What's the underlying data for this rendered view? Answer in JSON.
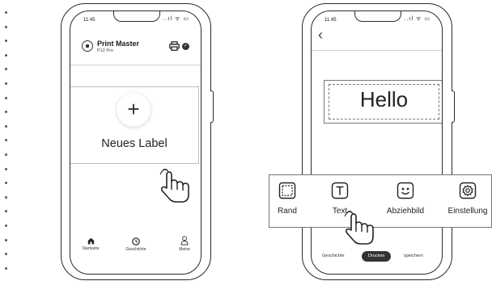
{
  "phone1": {
    "status_time": "11:45",
    "status_icons": "..ıl ᯤ ▭",
    "app_title": "Print Master",
    "app_model": "P12 Pro",
    "new_label": "Neues Label",
    "plus": "+",
    "tabs": [
      {
        "label": "Startseite",
        "icon": "home-icon"
      },
      {
        "label": "Geschichte",
        "icon": "clock-icon"
      },
      {
        "label": "Meine",
        "icon": "person-icon"
      }
    ]
  },
  "phone2": {
    "status_time": "11:45",
    "status_icons": "..ıl ᯤ ▭",
    "back": "‹",
    "label_text": "Hello",
    "tools": [
      {
        "label": "Rand",
        "icon": "border-frame-icon"
      },
      {
        "label": "Text",
        "icon": "text-t-icon"
      },
      {
        "label": "Abziehbild",
        "icon": "sticker-smile-icon"
      },
      {
        "label": "Einstellung",
        "icon": "settings-gear-icon"
      }
    ],
    "actions": {
      "history": "Geschichte",
      "print": "Drucken",
      "save": "speichern"
    }
  }
}
